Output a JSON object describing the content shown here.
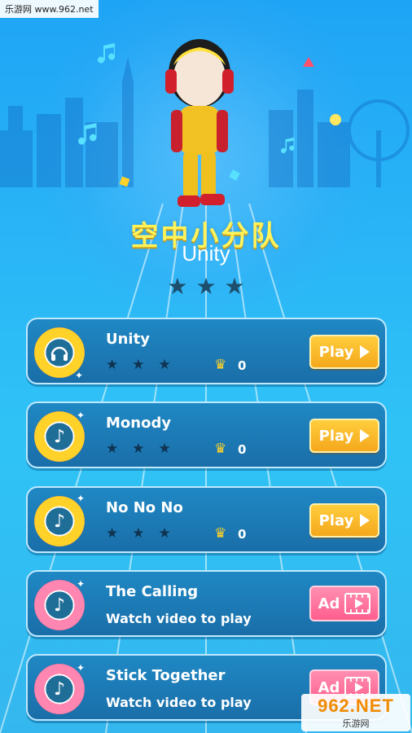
{
  "watermark_top": "乐游网 www.962.net",
  "hero": {
    "title_cn": "空中小分队",
    "song": "Unity",
    "stars": 3
  },
  "songs": [
    {
      "name": "Unity",
      "mode": "play",
      "stars": 3,
      "crowns": "0",
      "button": "Play",
      "disc": "gold",
      "icon": "headphone-icon"
    },
    {
      "name": "Monody",
      "mode": "play",
      "stars": 3,
      "crowns": "0",
      "button": "Play",
      "disc": "gold",
      "icon": "music-note-icon"
    },
    {
      "name": "No No No",
      "mode": "play",
      "stars": 3,
      "crowns": "0",
      "button": "Play",
      "disc": "gold",
      "icon": "music-note-icon"
    },
    {
      "name": "The Calling",
      "mode": "ad",
      "subtitle": "Watch video to play",
      "button": "Ad",
      "disc": "pink",
      "icon": "music-note-icon"
    },
    {
      "name": "Stick Together",
      "mode": "ad",
      "subtitle": "Watch video to play",
      "button": "Ad",
      "disc": "pink",
      "icon": "music-note-icon"
    }
  ],
  "watermark_bottom": {
    "logo": "962.NET",
    "sub": "乐游网"
  },
  "colors": {
    "play_button": "#f5a81c",
    "ad_button": "#ff5e8d",
    "card": "#1a6ea8",
    "title": "#fff35a"
  }
}
